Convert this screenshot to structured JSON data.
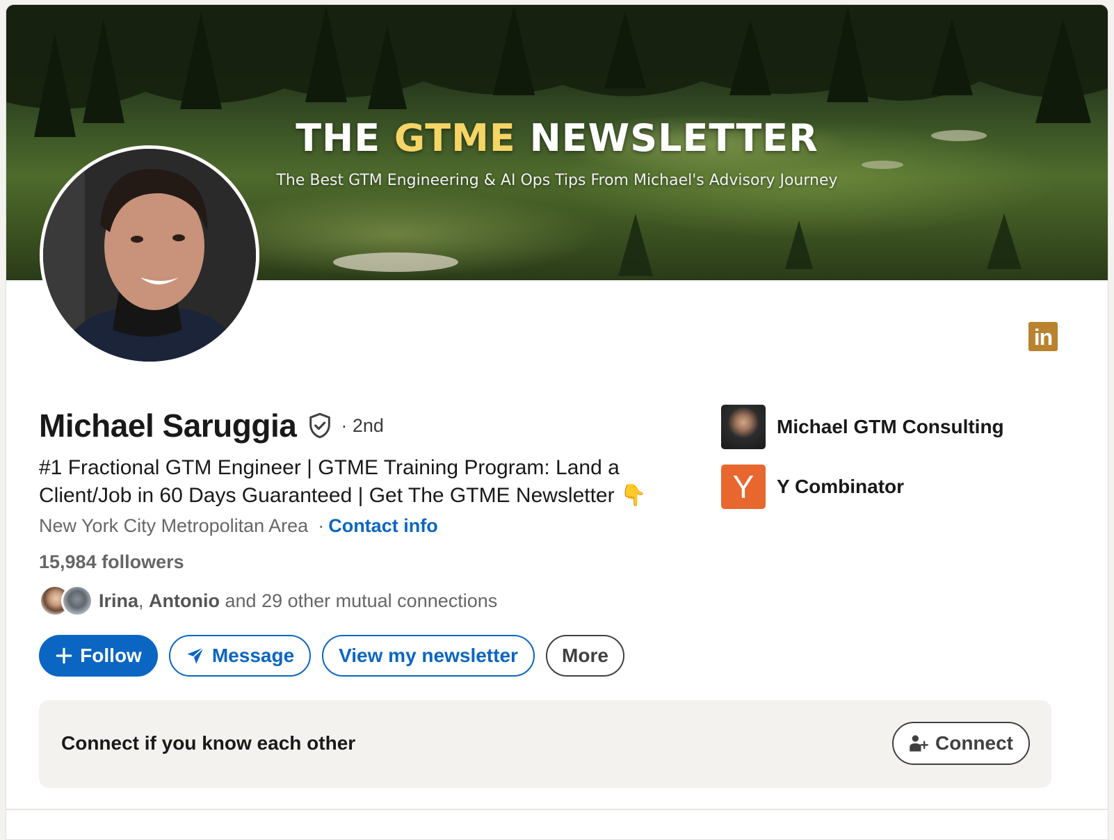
{
  "banner": {
    "title_part1": "THE ",
    "title_accent": "GTME",
    "title_part2": " NEWSLETTER",
    "subtitle": "The Best GTM Engineering & AI Ops Tips From Michael's Advisory Journey",
    "accent_color": "#f5d565"
  },
  "profile": {
    "name": "Michael Saruggia",
    "degree": "· 2nd",
    "headline": "#1 Fractional GTM Engineer | GTME Training Program: Land a Client/Job in 60 Days Guaranteed | Get The GTME Newsletter",
    "headline_emoji": "👇",
    "location": "New York City Metropolitan Area",
    "location_separator": "·",
    "contact_info_label": "Contact info",
    "followers": "15,984 followers",
    "mutual": {
      "name1": "Irina",
      "separator": ", ",
      "name2": "Antonio",
      "rest": " and 29 other mutual connections"
    }
  },
  "actions": {
    "follow_label": "Follow",
    "message_label": "Message",
    "newsletter_label": "View my newsletter",
    "more_label": "More"
  },
  "companies": [
    {
      "name": "Michael GTM Consulting",
      "logo": "photo"
    },
    {
      "name": "Y Combinator",
      "logo_letter": "Y",
      "logo_color": "#e8672f"
    }
  ],
  "linkedin_badge": "in",
  "connect_prompt": {
    "text": "Connect if you know each other",
    "button_label": "Connect"
  },
  "colors": {
    "primary": "#0a66c2",
    "badge": "#b8822f"
  },
  "icons": [
    "plus-icon",
    "paper-plane-icon",
    "verified-shield-icon",
    "add-person-icon",
    "linkedin-icon"
  ]
}
